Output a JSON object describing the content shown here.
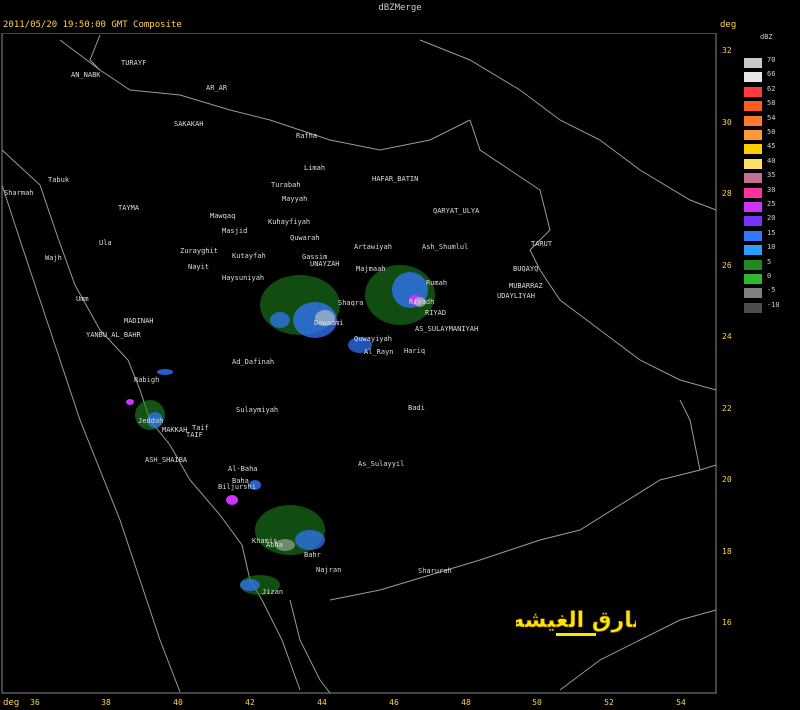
{
  "header": {
    "title": "dBZMerge",
    "timestamp": "2011/05/20 19:50:00 GMT Composite",
    "deg_label": "deg",
    "deg_label_bottom": "deg"
  },
  "axes": {
    "lon_ticks": [
      "36",
      "38",
      "40",
      "42",
      "44",
      "46",
      "48",
      "50",
      "52",
      "54"
    ],
    "lat_ticks": [
      "32",
      "30",
      "28",
      "26",
      "24",
      "22",
      "20",
      "18",
      "16"
    ]
  },
  "colorbar": {
    "unit": "dBZ",
    "labels": [
      "70",
      "66",
      "62",
      "58",
      "54",
      "50",
      "45",
      "40",
      "35",
      "30",
      "25",
      "20",
      "15",
      "10",
      "5",
      "0",
      "-5",
      "-10"
    ],
    "colors": [
      "#c8c8c8",
      "#e6e6e6",
      "#ff3b3b",
      "#ff5a1f",
      "#ff7a2e",
      "#ff9933",
      "#ffcc00",
      "#ffe066",
      "#c07090",
      "#ff3399",
      "#cc33ff",
      "#7a33ff",
      "#3377ff",
      "#2a9dff",
      "#1f8a1f",
      "#2eb82e",
      "#808080",
      "#4d4d4d"
    ]
  },
  "places": [
    {
      "name": "TURAYF",
      "id": "turayf"
    },
    {
      "name": "AN_NABK",
      "id": "an-nabk"
    },
    {
      "name": "AR_AR",
      "id": "ar-ar"
    },
    {
      "name": "SAKAKAH",
      "id": "sakakah"
    },
    {
      "name": "Rafha",
      "id": "rafha"
    },
    {
      "name": "Limah",
      "id": "limah"
    },
    {
      "name": "HAFAR_BATIN",
      "id": "hafar-batin"
    },
    {
      "name": "Turabah",
      "id": "turabah"
    },
    {
      "name": "Mayyah",
      "id": "mayyah"
    },
    {
      "name": "QARYAT_ULYA",
      "id": "qaryat-ulya"
    },
    {
      "name": "Tabuk",
      "id": "tabuk"
    },
    {
      "name": "Sharmah",
      "id": "sharmah"
    },
    {
      "name": "TAYMA",
      "id": "tayma"
    },
    {
      "name": "Mawqaq",
      "id": "mawqaq"
    },
    {
      "name": "Kuhayfiyah",
      "id": "kuhayfiyah"
    },
    {
      "name": "Masjid",
      "id": "masjid"
    },
    {
      "name": "Quwarah",
      "id": "quwarah"
    },
    {
      "name": "Artawiyah",
      "id": "artawiyah"
    },
    {
      "name": "Ash_Shumlul",
      "id": "ash-shumlul"
    },
    {
      "name": "TARUT",
      "id": "tarut"
    },
    {
      "name": "Ula",
      "id": "ula"
    },
    {
      "name": "Zurayghit",
      "id": "zurayghit"
    },
    {
      "name": "Kutayfah",
      "id": "kutayfah"
    },
    {
      "name": "Gassim",
      "id": "gassim"
    },
    {
      "name": "UNAYZAH",
      "id": "unayzah"
    },
    {
      "name": "Majmaah",
      "id": "majmaah"
    },
    {
      "name": "BUQAYQ",
      "id": "buqayq"
    },
    {
      "name": "Wajh",
      "id": "wajh"
    },
    {
      "name": "Nayit",
      "id": "nayit"
    },
    {
      "name": "Rumah",
      "id": "rumah"
    },
    {
      "name": "MUBARRAZ",
      "id": "mubarraz"
    },
    {
      "name": "Haysuniyah",
      "id": "haysuniyah"
    },
    {
      "name": "UDAYLIYAH",
      "id": "udayliyah"
    },
    {
      "name": "Umm",
      "id": "umm"
    },
    {
      "name": "Riyadh",
      "id": "riyadh"
    },
    {
      "name": "RIYAD",
      "id": "riyad"
    },
    {
      "name": "Dawadmi",
      "id": "dawadmi"
    },
    {
      "name": "Shaqra",
      "id": "shaqra"
    },
    {
      "name": "MADINAH",
      "id": "madinah"
    },
    {
      "name": "YANBU_AL_BAHR",
      "id": "yanbu"
    },
    {
      "name": "AS_SULAYMANIYAH",
      "id": "as-sulaymaniyah"
    },
    {
      "name": "Quwayiyah",
      "id": "quwayiyah"
    },
    {
      "name": "Al_Rayn",
      "id": "al-rayn"
    },
    {
      "name": "Hariq",
      "id": "hariq"
    },
    {
      "name": "Ad_Dafinah",
      "id": "ad-dafinah"
    },
    {
      "name": "Rabigh",
      "id": "rabigh"
    },
    {
      "name": "Sulaymiyah",
      "id": "sulaymiyah"
    },
    {
      "name": "Badi",
      "id": "badi"
    },
    {
      "name": "Jeddah",
      "id": "jeddah"
    },
    {
      "name": "MAKKAH",
      "id": "makkah"
    },
    {
      "name": "Taif",
      "id": "taif"
    },
    {
      "name": "TAIF",
      "id": "taif2"
    },
    {
      "name": "ASH_SHAIBA",
      "id": "ash-shaiba"
    },
    {
      "name": "As_Sulayyil",
      "id": "as-sulayyil"
    },
    {
      "name": "Al-Baha",
      "id": "al-baha"
    },
    {
      "name": "Baha",
      "id": "baha"
    },
    {
      "name": "Biljurshi",
      "id": "biljurshi"
    },
    {
      "name": "Khamis",
      "id": "khamis"
    },
    {
      "name": "Abha",
      "id": "abha"
    },
    {
      "name": "Bahr",
      "id": "bahr"
    },
    {
      "name": "Najran",
      "id": "najran"
    },
    {
      "name": "Sharurah",
      "id": "sharurah"
    },
    {
      "name": "Jizan",
      "id": "jizan"
    }
  ],
  "logo": {
    "text": "بارق الغيشه"
  }
}
